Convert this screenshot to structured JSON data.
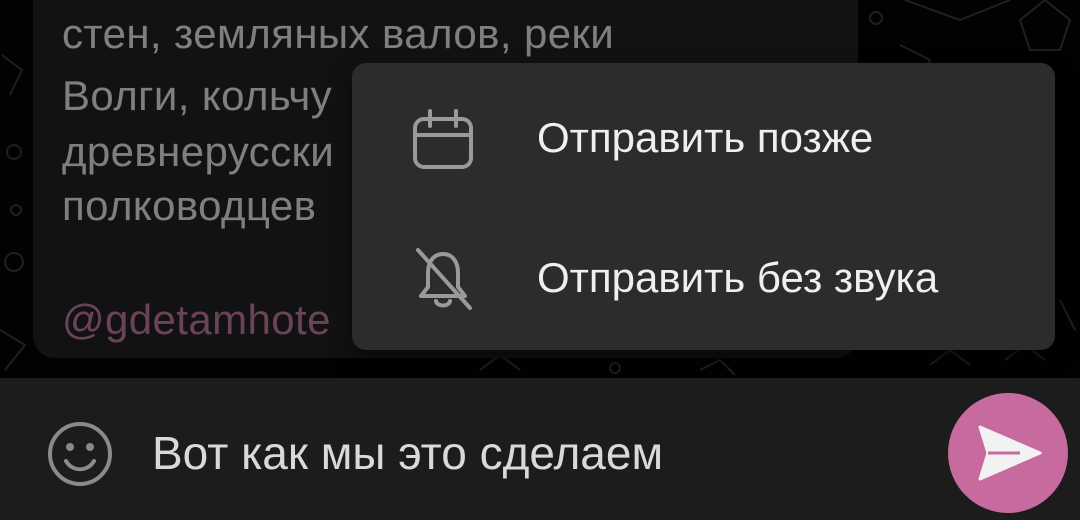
{
  "message": {
    "lines": [
      "стен, земляных валов, реки",
      "Волги, кольчу",
      "древнерусски",
      "полководцев"
    ],
    "link": "@gdetamhote"
  },
  "send_menu": {
    "items": [
      {
        "label": "Отправить позже",
        "icon": "calendar-icon"
      },
      {
        "label": "Отправить без звука",
        "icon": "bell-off-icon"
      }
    ]
  },
  "composer": {
    "text": "Вот как мы это сделаем",
    "emoji_icon": "emoji-icon",
    "send_icon": "send-icon"
  },
  "colors": {
    "accent": "#c76b9e",
    "link": "#c27aa6",
    "menu_bg": "#2c2c2c",
    "bubble_bg": "#222222"
  }
}
